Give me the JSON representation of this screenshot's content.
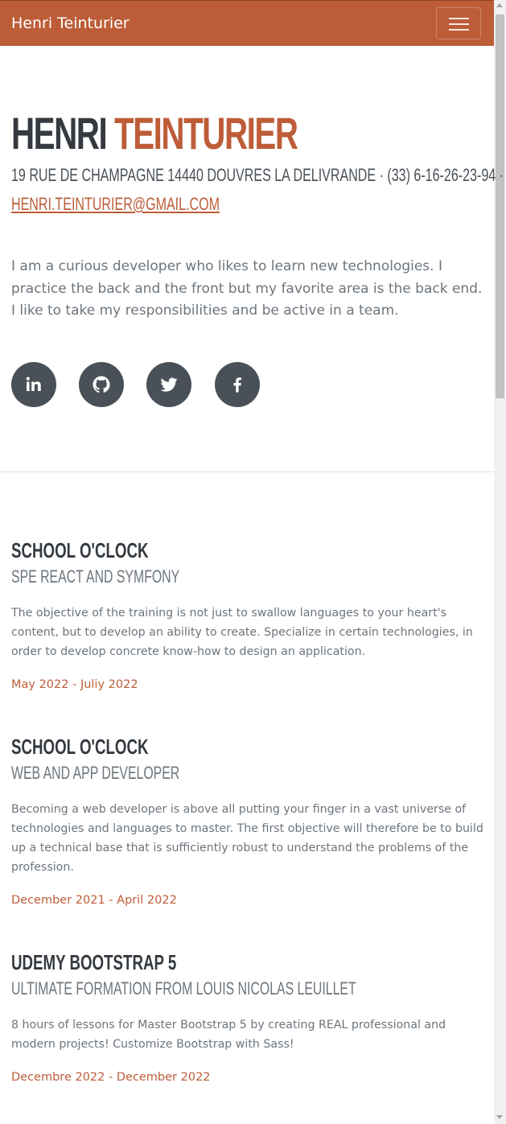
{
  "navbar": {
    "brand": "Henri Teinturier",
    "toggler_icon": "hamburger-icon"
  },
  "header": {
    "first_name": "HENRI",
    "last_name": "TEINTURIER",
    "address": "19 RUE DE CHAMPAGNE 14440 DOUVRES LA DELIVRANDE · (33) 6-16-26-23-94 ·",
    "email": "HENRI.TEINTURIER@GMAIL.COM"
  },
  "intro": "I am a curious developer who likes to learn new technologies. I practice the back and the front but my favorite area is the back end. I like to take my responsibilities and be active in a team.",
  "socials": [
    {
      "name": "linkedin-icon"
    },
    {
      "name": "github-icon"
    },
    {
      "name": "twitter-icon"
    },
    {
      "name": "facebook-icon"
    }
  ],
  "education": [
    {
      "title": "SCHOOL O'CLOCK",
      "subtitle": "SPE REACT AND SYMFONY",
      "description": "The objective of the training is not just to swallow languages to your heart's content, but to develop an ability to create. Specialize in certain technologies, in order to develop concrete know-how to design an application.",
      "dates": "May 2022 - Juliy 2022"
    },
    {
      "title": "SCHOOL O'CLOCK",
      "subtitle": "WEB AND APP DEVELOPER",
      "description": "Becoming a web developer is above all putting your finger in a vast universe of technologies and languages to master. The first objective will therefore be to build up a technical base that is sufficiently robust to understand the problems of the profession.",
      "dates": "December 2021 - April 2022"
    },
    {
      "title": "UDEMY BOOTSTRAP 5",
      "subtitle": "ULTIMATE FORMATION FROM LOUIS NICOLAS LEUILLET",
      "description": "8 hours of lessons for Master Bootstrap 5 by creating REAL professional and modern projects! Customize Bootstrap with Sass!",
      "dates": "Decembre 2022 - December 2022"
    }
  ],
  "colors": {
    "primary": "#bd5d38",
    "dark": "#343a40",
    "muted": "#6c757d",
    "icon_bg": "#495057"
  }
}
